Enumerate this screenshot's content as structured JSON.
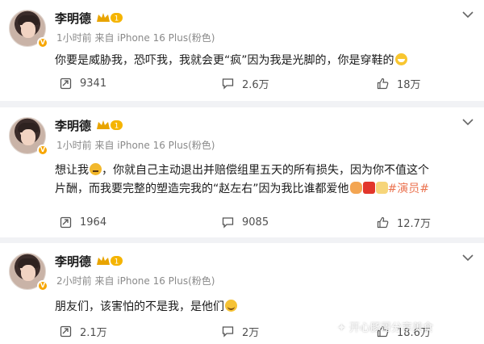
{
  "posts": [
    {
      "author": "李明德",
      "level": "1",
      "meta": "1小时前  来自 iPhone 16 Plus(粉色)",
      "text": "你要是威胁我，恐吓我，我就会更“疯”因为我是光脚的，你是穿鞋的",
      "emoji": "grin-emoji",
      "repost": "9341",
      "comment": "2.6万",
      "like": "18万"
    },
    {
      "author": "李明德",
      "level": "1",
      "meta": "1小时前  来自 iPhone 16 Plus(粉色)",
      "text_a": "想让我",
      "text_b": "，你就自己主动退出并赔偿组里五天的所有损失，因为你不值这个片酬，而我要完整的塑造完我的“赵左右”因为我比谁都爱他",
      "hashtag": "#演员#",
      "repost": "1964",
      "comment": "9085",
      "like": "12.7万"
    },
    {
      "author": "李明德",
      "level": "1",
      "meta": "2小时前  来自 iPhone 16 Plus(粉色)",
      "text": "朋友们，该害怕的不是我，是他们",
      "repost": "2.1万",
      "comment": "2万",
      "like": "18.6万"
    }
  ],
  "watermark": "开心豚哥分享美食",
  "colors": {
    "hashtag": "#eb7350",
    "badge": "#f7a600",
    "background": "#f1f2f5"
  }
}
